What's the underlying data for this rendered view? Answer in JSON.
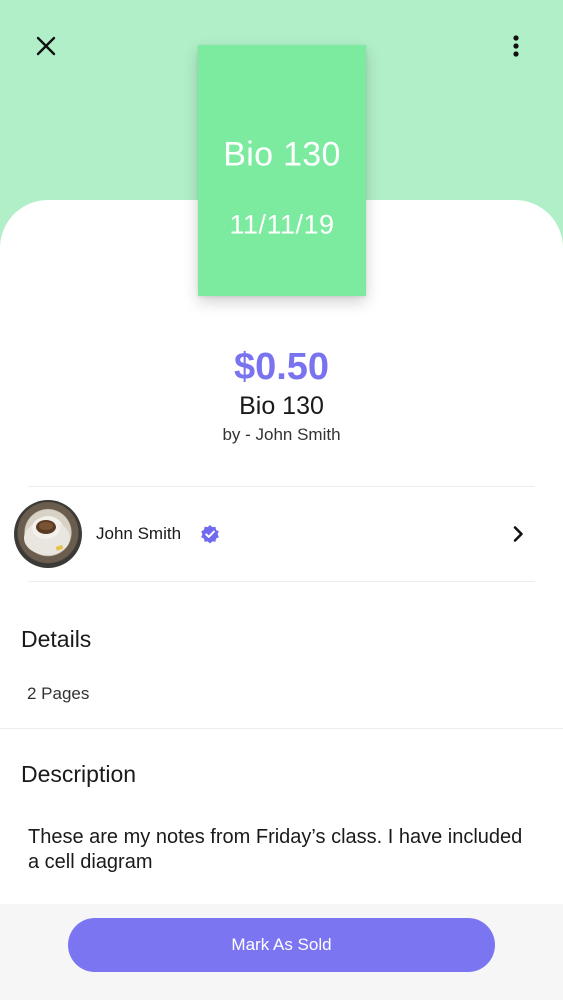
{
  "header": {
    "close_icon": "close-icon",
    "more_icon": "more-vertical-icon",
    "background_color": "#b1efc8"
  },
  "cover": {
    "title": "Bio 130",
    "date": "11/11/19",
    "color": "#7deb9f"
  },
  "listing": {
    "price": "$0.50",
    "title": "Bio 130",
    "byline": "by - John Smith",
    "accent_color": "#7a73f0"
  },
  "seller": {
    "name": "John Smith",
    "verified_icon": "verified-badge-icon",
    "chevron_icon": "chevron-right-icon"
  },
  "details": {
    "heading": "Details",
    "pages": "2 Pages"
  },
  "description": {
    "heading": "Description",
    "text": "These are my notes from Friday’s class. I have included a cell diagram"
  },
  "footer": {
    "button_label": "Mark As Sold",
    "button_color": "#7b75f2"
  }
}
